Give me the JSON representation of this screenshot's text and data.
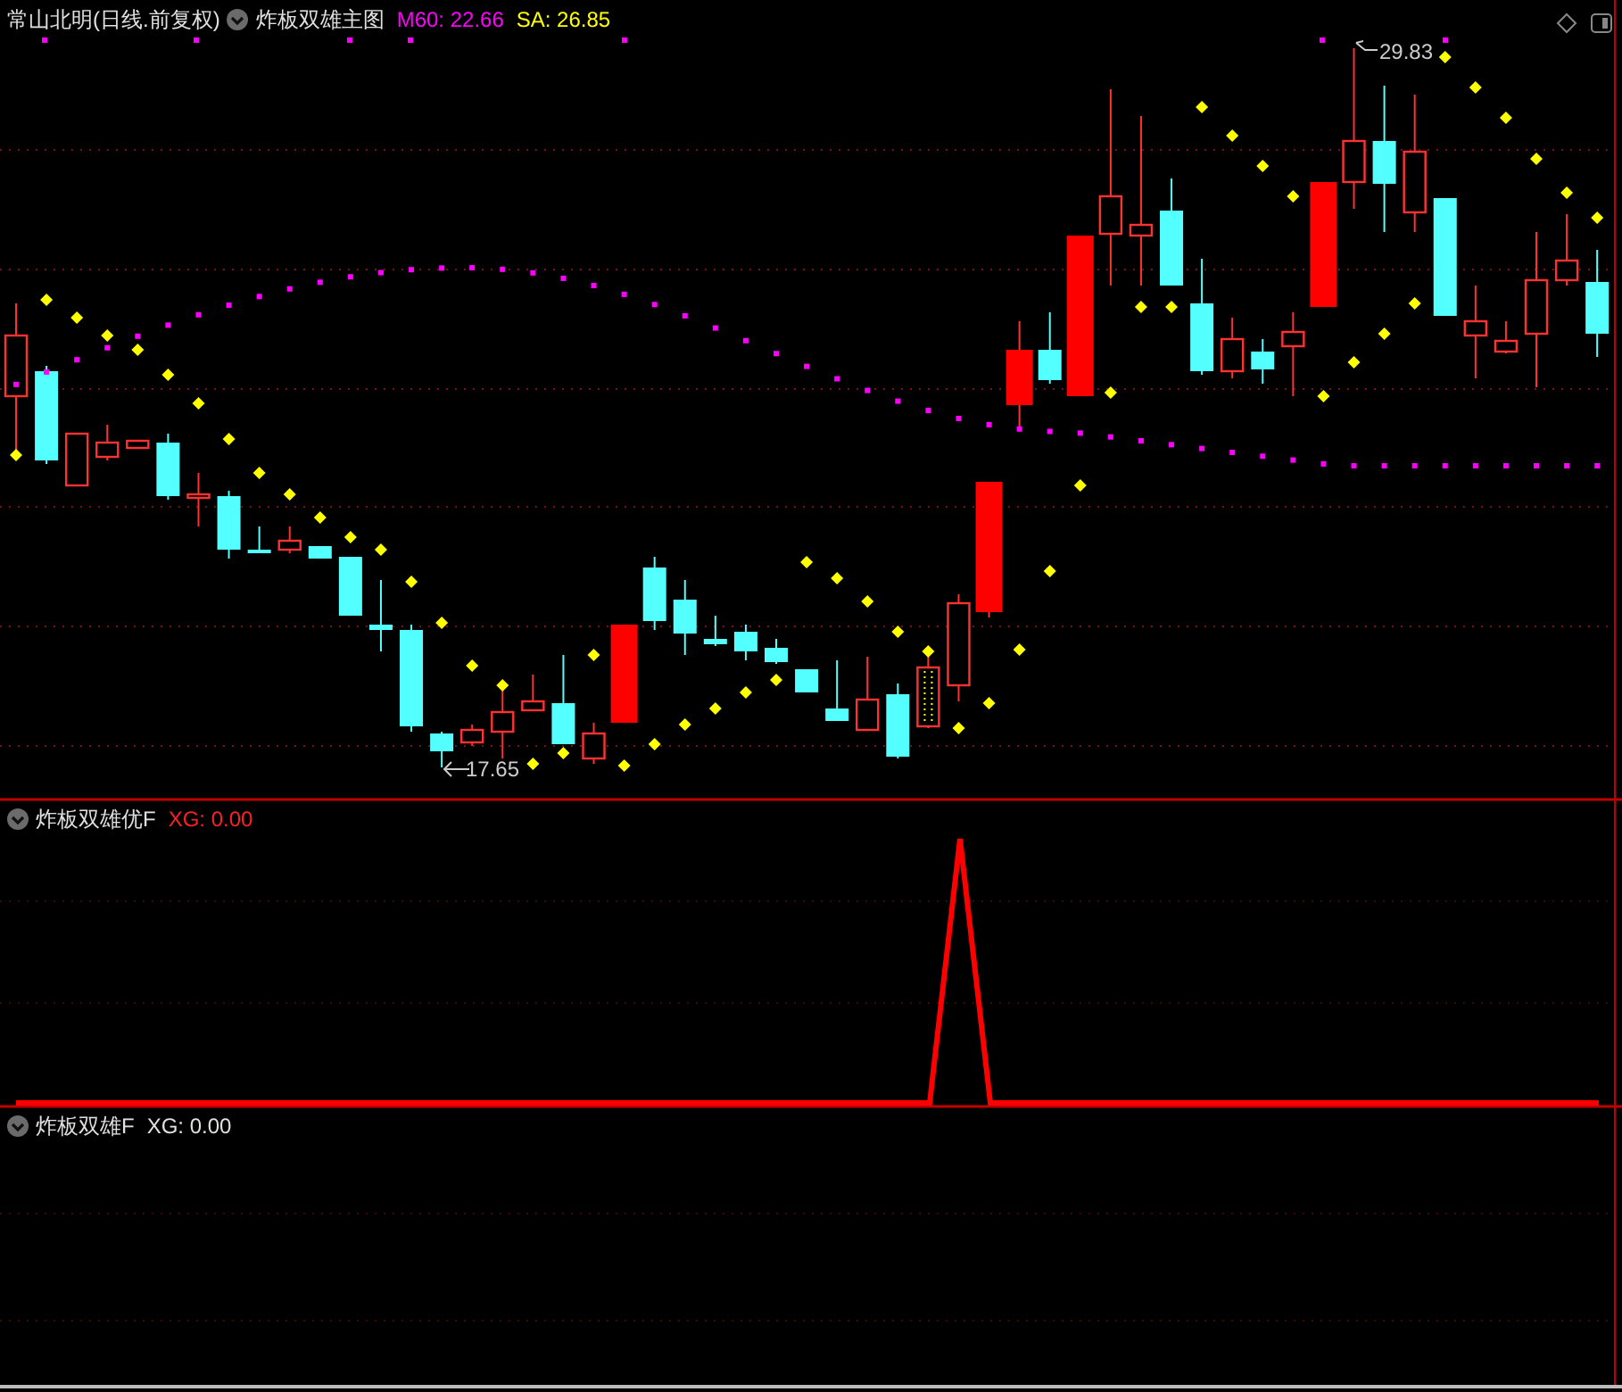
{
  "main_panel": {
    "stock_title": "常山北明(日线.前复权)",
    "indicator_name": "炸板双雄主图",
    "readings": [
      {
        "kind": "ma",
        "text": "M60: 22.66"
      },
      {
        "kind": "sa",
        "text": "SA: 26.85"
      }
    ],
    "low_label": "17.65",
    "high_label": "29.83"
  },
  "panels": [
    {
      "name": "炸板双雄优F",
      "reading": "XG: 0.00",
      "kind": "signal"
    },
    {
      "name": "炸板双雄F",
      "reading": "XG: 0.00",
      "kind": "plain"
    }
  ]
}
